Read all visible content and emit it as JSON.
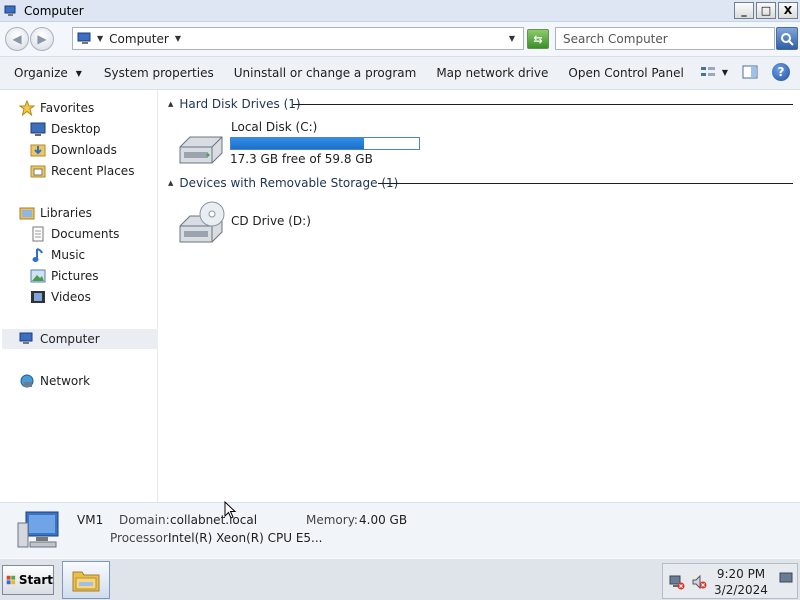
{
  "window": {
    "title": "Computer"
  },
  "titlebar_buttons": {
    "minimize": "_",
    "maximize": "□",
    "close": "X"
  },
  "address": {
    "crumb": "Computer",
    "search_placeholder": "Search Computer"
  },
  "commands": {
    "organize": "Organize",
    "system_properties": "System properties",
    "uninstall": "Uninstall or change a program",
    "map_drive": "Map network drive",
    "control_panel": "Open Control Panel"
  },
  "sidebar": {
    "favorites": "Favorites",
    "desktop": "Desktop",
    "downloads": "Downloads",
    "recent_places": "Recent Places",
    "libraries": "Libraries",
    "documents": "Documents",
    "music": "Music",
    "pictures": "Pictures",
    "videos": "Videos",
    "computer": "Computer",
    "network": "Network"
  },
  "groups": {
    "hdd_header": "Hard Disk Drives (1)",
    "removable_header": "Devices with Removable Storage (1)"
  },
  "drives": {
    "local": {
      "label": "Local Disk (C:)",
      "space": "17.3 GB free of 59.8 GB",
      "used_fraction": 0.71
    },
    "cd": {
      "label": "CD Drive (D:)"
    }
  },
  "details": {
    "name": "VM1",
    "domain_label": "Domain:",
    "domain_value": "collabnet.local",
    "memory_label": "Memory:",
    "memory_value": "4.00 GB",
    "processor_label": "Processor:",
    "processor_value": "Intel(R) Xeon(R) CPU E5..."
  },
  "taskbar": {
    "start_label": "Start",
    "time": "9:20 PM",
    "date": "3/2/2024"
  }
}
